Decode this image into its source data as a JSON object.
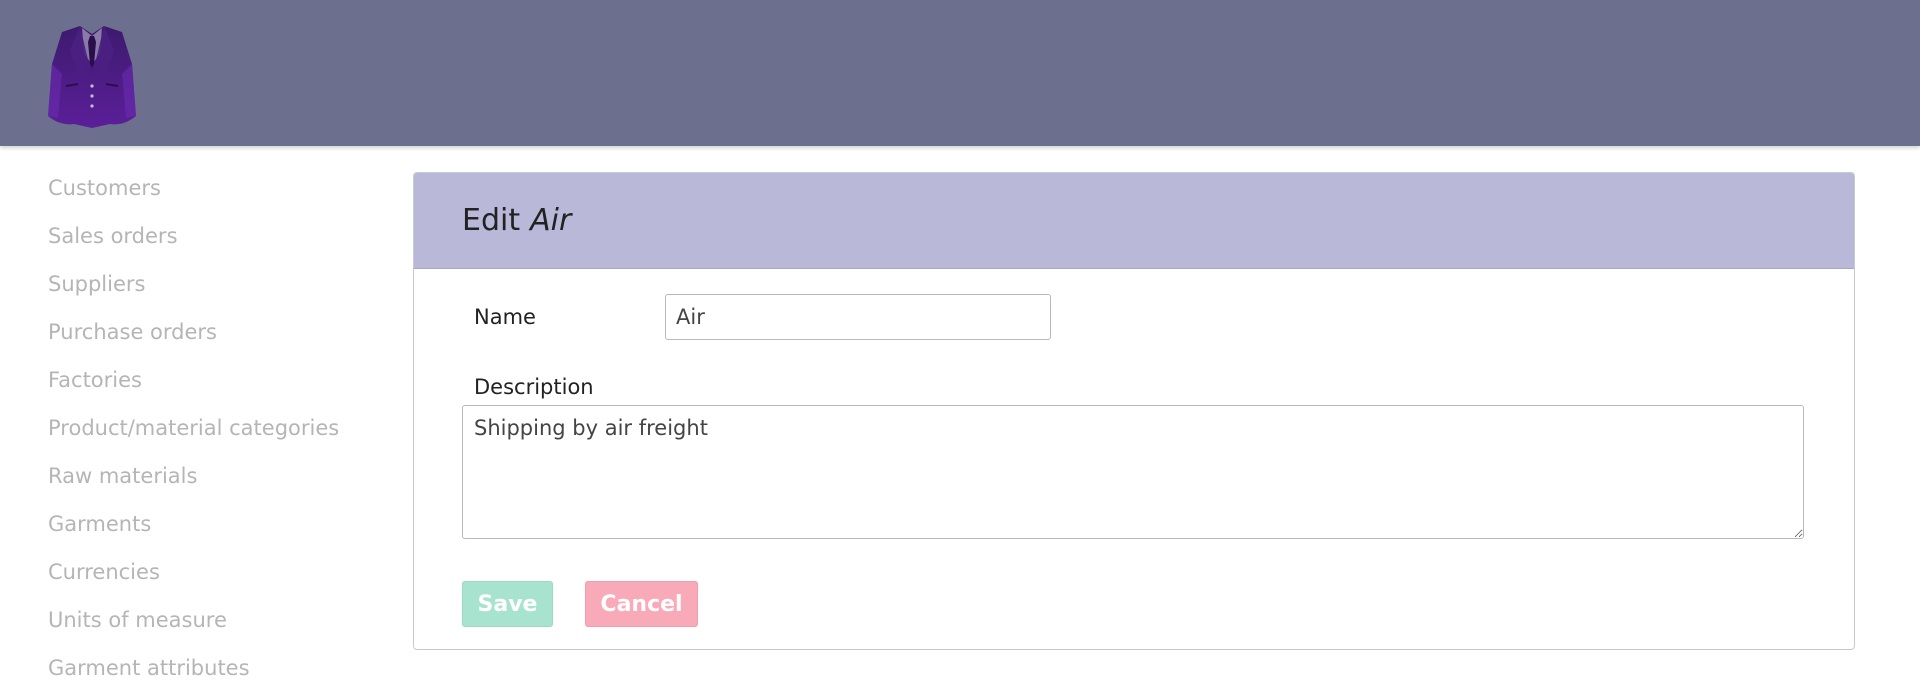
{
  "header": {
    "logo_icon": "suit-jacket-logo-icon",
    "background_color": "#6c6f8d"
  },
  "sidebar": {
    "items": [
      {
        "label": "Customers"
      },
      {
        "label": "Sales orders"
      },
      {
        "label": "Suppliers"
      },
      {
        "label": "Purchase orders"
      },
      {
        "label": "Factories"
      },
      {
        "label": "Product/material categories"
      },
      {
        "label": "Raw materials"
      },
      {
        "label": "Garments"
      },
      {
        "label": "Currencies"
      },
      {
        "label": "Units of measure"
      },
      {
        "label": "Garment attributes"
      }
    ]
  },
  "form": {
    "title_prefix": "Edit",
    "title_name": "Air",
    "name_label": "Name",
    "name_value": "Air",
    "description_label": "Description",
    "description_value": "Shipping by air freight",
    "save_label": "Save",
    "cancel_label": "Cancel"
  },
  "colors": {
    "panel_header": "#bab8d9",
    "save_button": "#a8e3cf",
    "cancel_button": "#f9aab8",
    "sidebar_text": "#b5b5b5"
  }
}
